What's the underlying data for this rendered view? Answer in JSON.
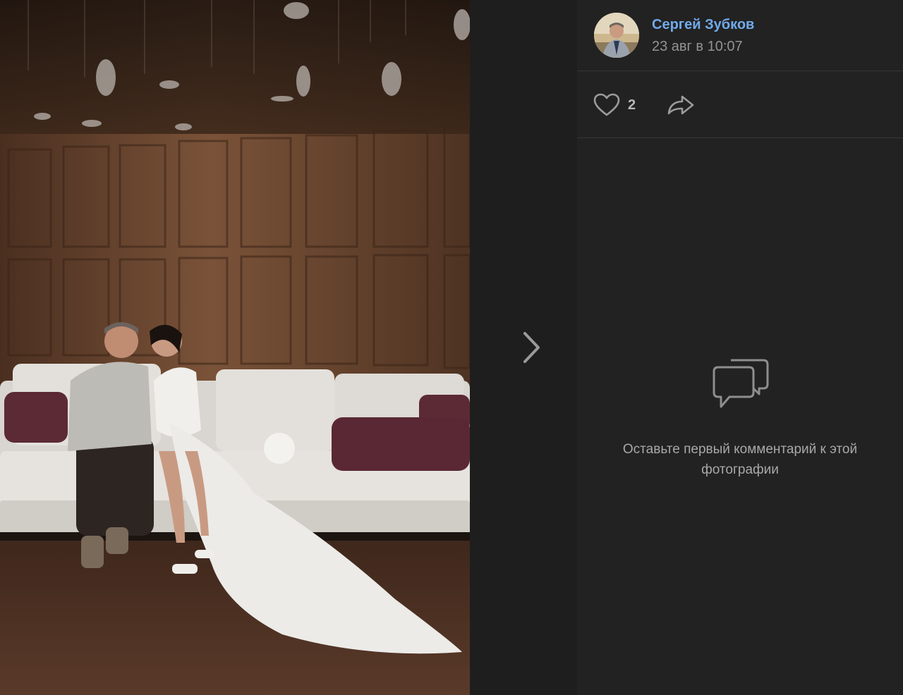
{
  "author": {
    "name": "Сергей Зубков",
    "date": "23 авг в 10:07",
    "avatar_icon": "author-avatar"
  },
  "actions": {
    "like_count": "2",
    "like_icon": "heart-icon",
    "share_icon": "share-arrow-icon"
  },
  "navigation": {
    "next_icon": "chevron-right-icon"
  },
  "comments": {
    "empty_text": "Оставьте первый комментарий к этой фотографии",
    "icon": "comment-bubbles-icon"
  },
  "colors": {
    "link": "#71aaeb",
    "background": "#1e1e1e",
    "panel": "#222222",
    "divider": "#363636"
  }
}
